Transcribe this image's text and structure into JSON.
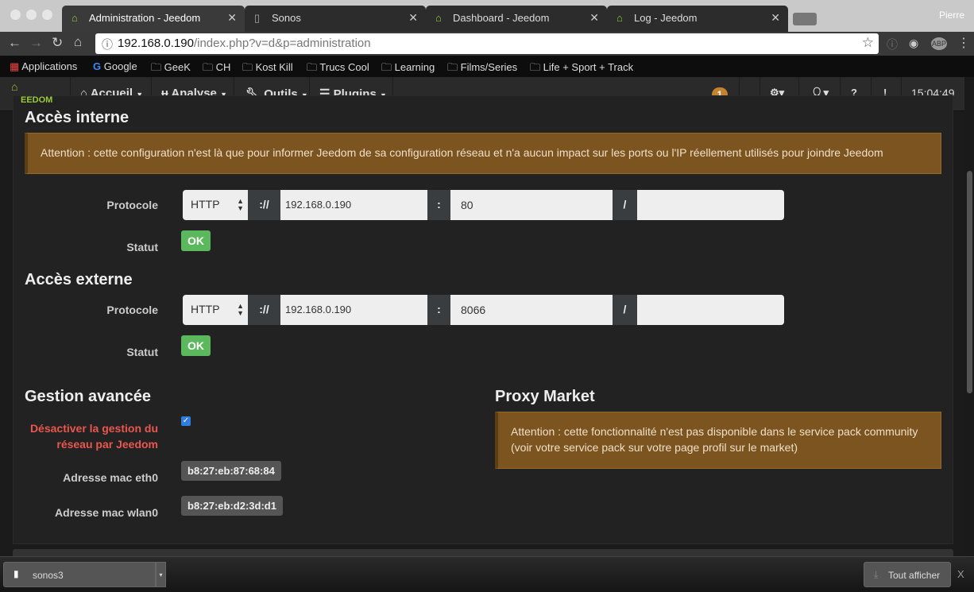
{
  "browser": {
    "tabs": [
      {
        "title": "Administration - Jeedom",
        "active": true
      },
      {
        "title": "Sonos"
      },
      {
        "title": "Dashboard - Jeedom"
      },
      {
        "title": "Log - Jeedom"
      }
    ],
    "user": "Pierre",
    "url_host": "192.168.0.190",
    "url_path": "/index.php?v=d&p=administration",
    "bookmarks": [
      "Applications",
      "Google",
      "GeeK",
      "CH",
      "Kost Kill",
      "Trucs Cool",
      "Learning",
      "Films/Series",
      "Life + Sport + Track"
    ]
  },
  "nav": {
    "logo": "EEDOM",
    "items": [
      "Accueil",
      "Analyse",
      "Outils",
      "Plugins"
    ],
    "badge": "1",
    "time": "15:04:49"
  },
  "internal": {
    "title": "Accès interne",
    "alert": "Attention : cette configuration n'est là que pour informer Jeedom de sa configuration réseau et n'a aucun impact sur les ports ou l'IP réellement utilisés pour joindre Jeedom",
    "protocol_label": "Protocole",
    "protocol": "HTTP",
    "sep1": "://",
    "ip": "192.168.0.190",
    "sep2": ":",
    "port": "80",
    "sep3": "/",
    "path": "",
    "status_label": "Statut",
    "status": "OK"
  },
  "external": {
    "title": "Accès externe",
    "protocol_label": "Protocole",
    "protocol": "HTTP",
    "sep1": "://",
    "ip": "192.168.0.190",
    "sep2": ":",
    "port": "8066",
    "sep3": "/",
    "path": "",
    "status_label": "Statut",
    "status": "OK"
  },
  "advanced": {
    "title": "Gestion avancée",
    "disable_label": "Désactiver la gestion du réseau par Jeedom",
    "disable_checked": true,
    "eth0_label": "Adresse mac eth0",
    "eth0": "b8:27:eb:87:68:84",
    "wlan0_label": "Adresse mac wlan0",
    "wlan0": "b8:27:eb:d2:3d:d1"
  },
  "proxy": {
    "title": "Proxy Market",
    "alert": "Attention : cette fonctionnalité n'est pas disponible dans le service pack community (voir votre service pack sur votre page profil sur le market)"
  },
  "downloads": {
    "file": "sonos3",
    "show_all": "Tout afficher",
    "close": "X"
  },
  "colors": {
    "alert_bg": "#7b5420",
    "ok": "#5cb85c",
    "danger_label": "#e9574f",
    "accent": "#9c3"
  }
}
